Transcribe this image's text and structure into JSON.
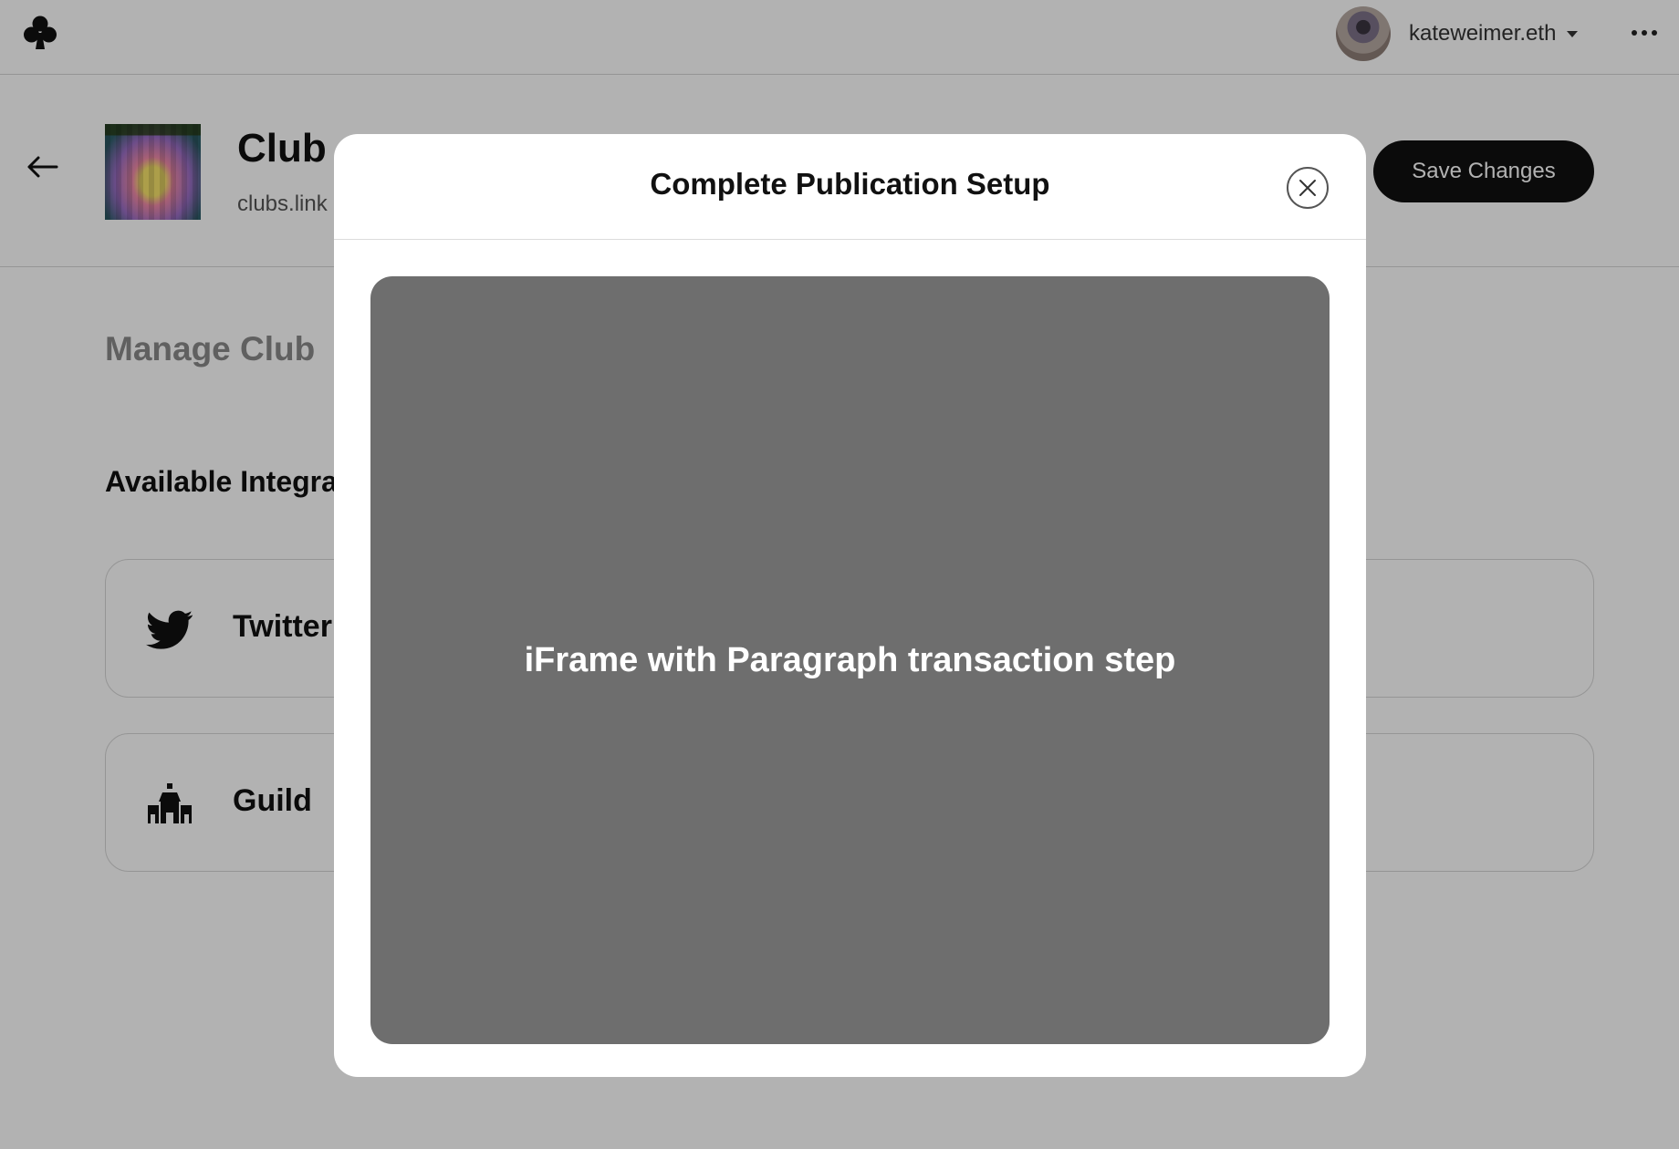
{
  "topbar": {
    "logo_icon": "club-suit-icon",
    "username": "kateweimer.eth",
    "caret_icon": "caret-down-icon",
    "more_icon": "more-dots-icon"
  },
  "header": {
    "back_icon": "arrow-left-icon",
    "club_name": "Club",
    "club_link": "clubs.link",
    "save_label": "Save Changes"
  },
  "main": {
    "section_title": "Manage Club",
    "available_title": "Available Integra",
    "integrations": [
      {
        "label": "Twitter",
        "icon": "twitter-icon"
      },
      {
        "label": "Guild",
        "icon": "guild-castle-icon"
      }
    ]
  },
  "modal": {
    "title": "Complete Publication Setup",
    "close_icon": "close-icon",
    "iframe_text": "iFrame with Paragraph transaction step"
  },
  "colors": {
    "overlay": "rgba(0,0,0,0.30)",
    "button": "#111111",
    "iframe_bg": "#6e6e6e"
  }
}
